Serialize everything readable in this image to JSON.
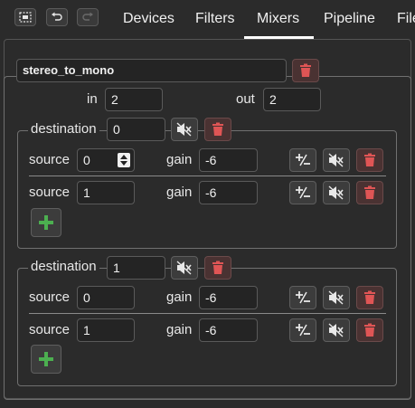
{
  "toolbar": {
    "tabs": [
      "Devices",
      "Filters",
      "Mixers",
      "Pipeline",
      "File"
    ],
    "active_tab": "Mixers"
  },
  "mixer": {
    "name": "stereo_to_mono",
    "in_label": "in",
    "in_value": "2",
    "out_label": "out",
    "out_value": "2",
    "destinations": [
      {
        "label": "destination",
        "value": "0",
        "sources": [
          {
            "label": "source",
            "value": "0",
            "gain_label": "gain",
            "gain": "-6"
          },
          {
            "label": "source",
            "value": "1",
            "gain_label": "gain",
            "gain": "-6"
          }
        ]
      },
      {
        "label": "destination",
        "value": "1",
        "sources": [
          {
            "label": "source",
            "value": "0",
            "gain_label": "gain",
            "gain": "-6"
          },
          {
            "label": "source",
            "value": "1",
            "gain_label": "gain",
            "gain": "-6"
          }
        ]
      }
    ]
  },
  "icons": {
    "delete": "trash-icon",
    "mute": "speaker-muted-icon",
    "invert": "plus-minus-icon",
    "add": "plus-icon"
  },
  "colors": {
    "background": "#2b2b2b",
    "delete_icon": "#e05555",
    "add_icon": "#4caf50"
  }
}
